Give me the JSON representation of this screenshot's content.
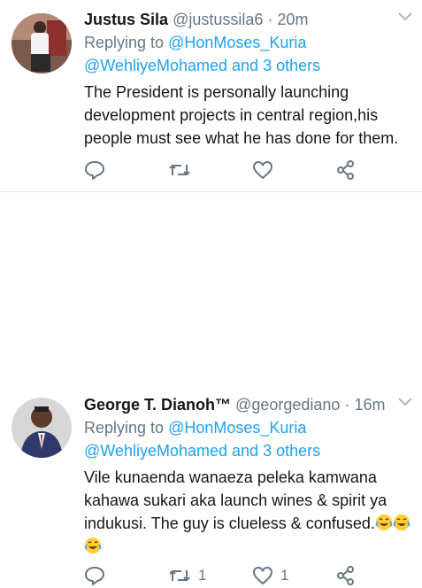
{
  "tweets": [
    {
      "name": "Justus Sila",
      "handle": "@justussila6",
      "separator": "·",
      "time": "20m",
      "replying_prefix": "Replying to",
      "mention1": "@HonMoses_Kuria",
      "mention2": "@WehliyeMohamed",
      "and_others": "and 3 others",
      "text_lines": [
        "The President is personally launching",
        "development projects in central region,his",
        "people must see what he has done for them."
      ],
      "reply_count": "",
      "retweet_count": "",
      "like_count": ""
    },
    {
      "name": "George T. Dianoh™",
      "handle": "@georgediano",
      "separator": "·",
      "time": "16m",
      "replying_prefix": "Replying to",
      "mention1": "@HonMoses_Kuria",
      "mention2": "@WehliyeMohamed",
      "and_others": "and 3 others",
      "text_lines": [
        "Vile kunaenda wanaeza peleka kamwana",
        "kahawa sukari aka launch wines & spirit ya",
        "indukusi. The guy is clueless & confused."
      ],
      "reply_count": "",
      "retweet_count": "1",
      "like_count": "1"
    }
  ],
  "icons": {
    "reply": "reply-icon",
    "retweet": "retweet-icon",
    "like": "heart-icon",
    "share": "share-icon",
    "menu": "chevron-down-icon",
    "emoji": "tears-of-joy-emoji-icon"
  },
  "colors": {
    "link": "#1da1f2",
    "secondary": "#657786",
    "text": "#14171a",
    "divider": "#e1e8ed"
  }
}
